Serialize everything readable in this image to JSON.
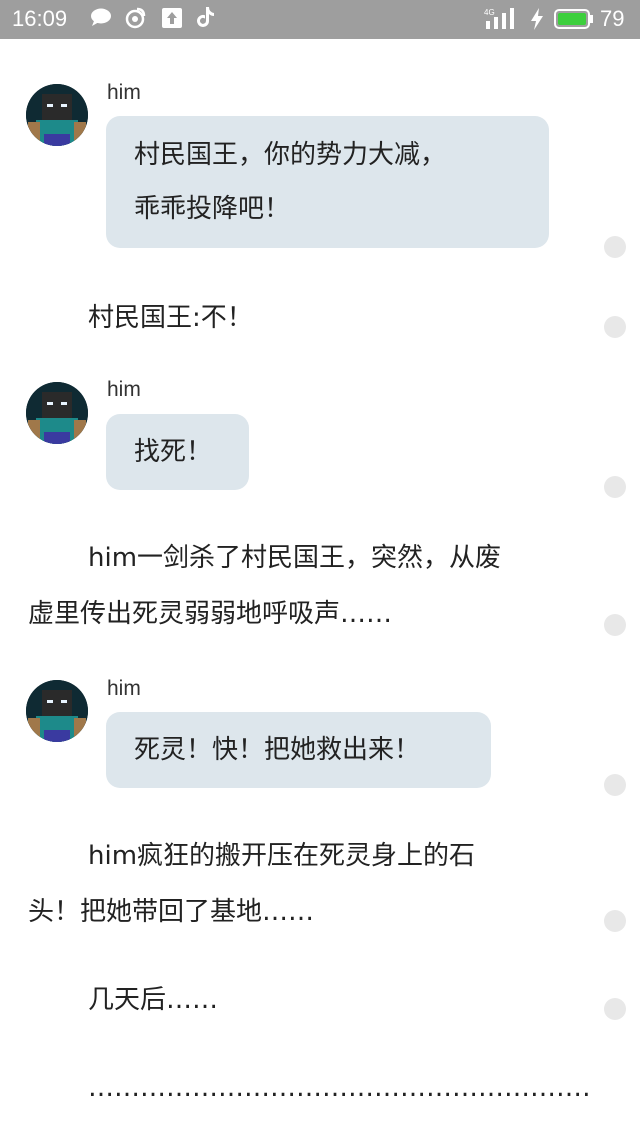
{
  "status_bar": {
    "time": "16:09",
    "battery_level": "79",
    "icons": [
      "chat-bubble-icon",
      "weibo-icon",
      "upload-icon",
      "tiktok-icon",
      "signal-icon",
      "charging-icon",
      "battery-icon"
    ]
  },
  "messages": [
    {
      "speaker": "him",
      "lines": [
        "村民国王，你的势力大减，",
        "乖乖投降吧！"
      ]
    },
    {
      "narration": "村民国王:不！"
    },
    {
      "speaker": "him",
      "lines": [
        "找死！"
      ]
    },
    {
      "narration_lines": [
        "him一剑杀了村民国王，突然，从废",
        "虚里传出死灵弱弱地呼吸声……"
      ]
    },
    {
      "speaker": "him",
      "lines": [
        "死灵！快！把她救出来！"
      ]
    },
    {
      "narration_lines": [
        "him疯狂的搬开压在死灵身上的石",
        "头！把她带回了基地……"
      ]
    },
    {
      "narration": "几天后……"
    },
    {
      "narration": "……………………………………………………………"
    }
  ],
  "colors": {
    "status_bar_bg": "#9e9e9e",
    "bubble_bg": "#dde6ec",
    "battery_fill": "#3dcf3d"
  }
}
